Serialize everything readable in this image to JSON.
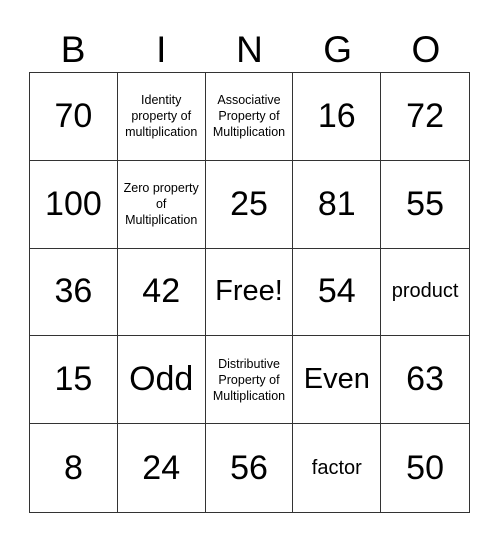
{
  "header": [
    "B",
    "I",
    "N",
    "G",
    "O"
  ],
  "cells": [
    {
      "text": "70",
      "size": "big"
    },
    {
      "text": "Identity property of multiplication",
      "size": "small"
    },
    {
      "text": "Associative Property of Multiplication",
      "size": "small"
    },
    {
      "text": "16",
      "size": "big"
    },
    {
      "text": "72",
      "size": "big"
    },
    {
      "text": "100",
      "size": "big"
    },
    {
      "text": "Zero property of Multiplication",
      "size": "small"
    },
    {
      "text": "25",
      "size": "big"
    },
    {
      "text": "81",
      "size": "big"
    },
    {
      "text": "55",
      "size": "big"
    },
    {
      "text": "36",
      "size": "big"
    },
    {
      "text": "42",
      "size": "big"
    },
    {
      "text": "Free!",
      "size": "mid"
    },
    {
      "text": "54",
      "size": "big"
    },
    {
      "text": "product",
      "size": "word"
    },
    {
      "text": "15",
      "size": "big"
    },
    {
      "text": "Odd",
      "size": "big"
    },
    {
      "text": "Distributive Property of Multiplication",
      "size": "small"
    },
    {
      "text": "Even",
      "size": "mid"
    },
    {
      "text": "63",
      "size": "big"
    },
    {
      "text": "8",
      "size": "big"
    },
    {
      "text": "24",
      "size": "big"
    },
    {
      "text": "56",
      "size": "big"
    },
    {
      "text": "factor",
      "size": "word"
    },
    {
      "text": "50",
      "size": "big"
    }
  ]
}
